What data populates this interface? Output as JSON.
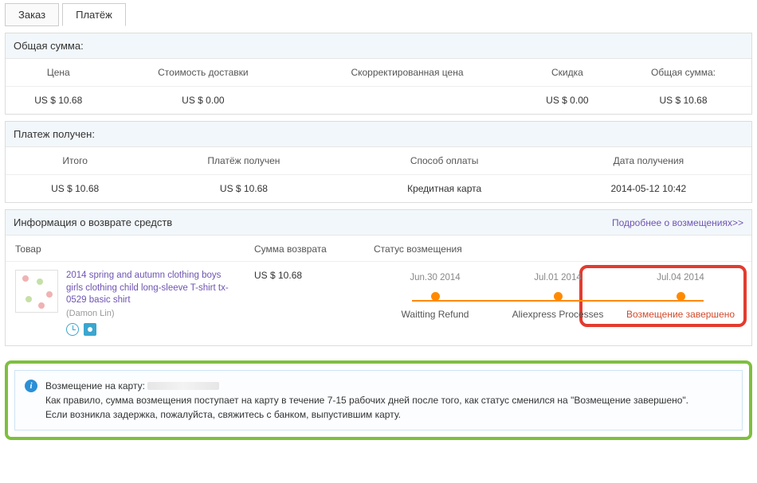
{
  "tabs": {
    "order": "Заказ",
    "payment": "Платёж"
  },
  "total_panel": {
    "title": "Общая сумма:",
    "headers": {
      "price": "Цена",
      "shipping": "Стоимость доставки",
      "adjusted": "Скорректированная цена",
      "discount": "Скидка",
      "total": "Общая сумма:"
    },
    "values": {
      "price": "US $ 10.68",
      "shipping": "US $ 0.00",
      "adjusted": "",
      "discount": "US $ 0.00",
      "total": "US $ 10.68"
    }
  },
  "received_panel": {
    "title": "Платеж получен:",
    "headers": {
      "subtotal": "Итого",
      "received": "Платёж получен",
      "method": "Способ оплаты",
      "date": "Дата получения"
    },
    "values": {
      "subtotal": "US $ 10.68",
      "received": "US $ 10.68",
      "method": "Кредитная карта",
      "date": "2014-05-12 10:42"
    }
  },
  "refund_panel": {
    "title": "Информация о возврате средств",
    "details_link": "Подробнее о возмещениях>>",
    "cols": {
      "product": "Товар",
      "amount": "Сумма возврата",
      "status": "Статус возмещения"
    },
    "product": {
      "name": "2014 spring and autumn clothing boys girls clothing child long-sleeve T-shirt tx-0529 basic shirt",
      "seller": "(Damon Lin)"
    },
    "amount": "US $ 10.68",
    "timeline": [
      {
        "date": "Jun.30 2014",
        "label": "Waitting Refund"
      },
      {
        "date": "Jul.01 2014",
        "label": "Aliexpress Processes"
      },
      {
        "date": "Jul.04 2014",
        "label": "Возмещение завершено"
      }
    ]
  },
  "info": {
    "line1_prefix": "Возмещение на карту: ",
    "line2": "Как правило, сумма возмещения поступает на карту в течение 7-15 рабочих дней после того, как статус сменился на \"Возмещение завершено\".",
    "line3": "Если возникла задержка, пожалуйста, свяжитесь с банком, выпустившим карту."
  }
}
